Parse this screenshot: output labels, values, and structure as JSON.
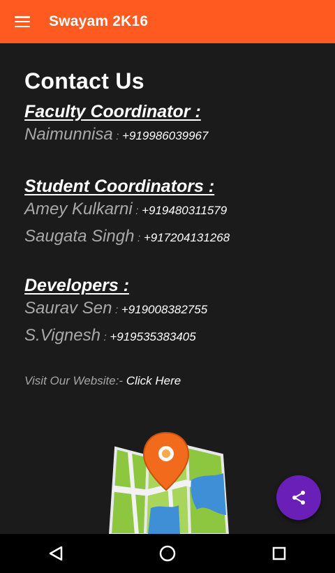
{
  "app_bar": {
    "title": "Swayam 2K16",
    "menu_icon": "hamburger-menu-icon",
    "color": "#ff5a1f"
  },
  "page": {
    "title": "Contact Us"
  },
  "sections": [
    {
      "heading": "Faculty Coordinator :",
      "contacts": [
        {
          "name": "Naimunnisa",
          "separator": " : ",
          "phone": "+919986039967"
        }
      ]
    },
    {
      "heading": "Student Coordinators :",
      "contacts": [
        {
          "name": "Amey Kulkarni",
          "separator": " : ",
          "phone": "+919480311579"
        },
        {
          "name": "Saugata Singh",
          "separator": " : ",
          "phone": "+917204131268"
        }
      ]
    },
    {
      "heading": "Developers :",
      "contacts": [
        {
          "name": "Saurav Sen",
          "separator": " : ",
          "phone": "+919008382755"
        },
        {
          "name": "S.Vignesh",
          "separator": " : ",
          "phone": "+919535383405"
        }
      ]
    }
  ],
  "website": {
    "label": "Visit Our Website:- ",
    "link_text": "Click Here"
  },
  "fab": {
    "icon": "share-icon",
    "color": "#6a1fb8"
  },
  "nav_bar": {
    "back_icon": "back-triangle-icon",
    "home_icon": "home-circle-icon",
    "recents_icon": "recents-square-icon"
  }
}
